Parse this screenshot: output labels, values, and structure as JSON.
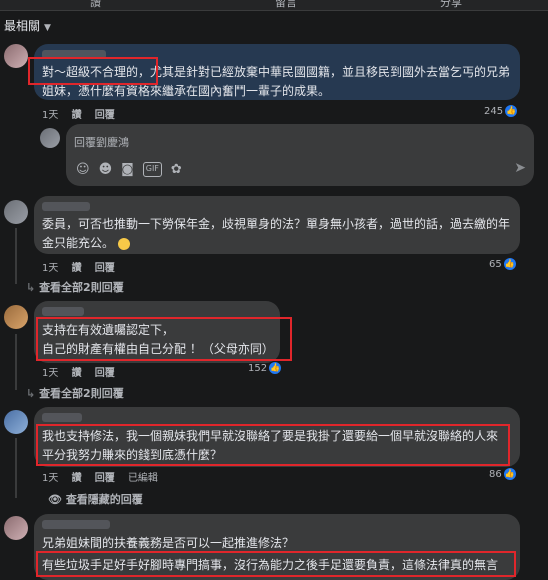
{
  "action_bar": {
    "like": "讚",
    "comment": "留言",
    "share": "分享"
  },
  "sort_label": "最相關",
  "comments": [
    {
      "text": "對～超級不合理的，尤其是針對已經放棄中華民國國籍，並且移民到國外去當乞丐的兄弟姐妹，憑什麼有資格來繼承在國內奮鬥一輩子的成果。",
      "time": "1天",
      "like": "讚",
      "reply": "回覆",
      "count": "245"
    },
    {
      "text": "委員，可否也推動一下勞保年金，歧視單身的法？單身無小孩者，過世的話，過去繳的年金只能充公。",
      "time": "1天",
      "like": "讚",
      "reply": "回覆",
      "count": "65",
      "more": "查看全部2則回覆"
    },
    {
      "text": "支持在有效遺囑認定下，\n自己的財產有權由自己分配 ！（父母亦同）",
      "time": "1天",
      "like": "讚",
      "reply": "回覆",
      "count": "152",
      "more": "查看全部2則回覆"
    },
    {
      "text": "我也支持修法，我一個親妹我們早就沒聯絡了要是我掛了還要給一個早就沒聯絡的人來平分我努力賺來的錢到底憑什麼？",
      "time": "1天",
      "like": "讚",
      "reply": "回覆",
      "edited": "已編輯",
      "count": "86",
      "more": "查看隱藏的回覆"
    },
    {
      "text": "兄弟姐妹間的扶養義務是否可以一起推進修法？",
      "text2": "有些垃圾手足好手好腳時專門搞事，沒行為能力之後手足還要負責，這條法律真的無言"
    }
  ],
  "reply_box": {
    "placeholder": "回覆劉慶鴻"
  },
  "icons": [
    "sticker-icon",
    "emoji-icon",
    "camera-icon",
    "gif-icon",
    "avatar-sticker-icon",
    "send-icon"
  ],
  "colors": {
    "like_blue": "#2078f4",
    "highlight_red": "#e0262b",
    "bubble": "#3a3b3c",
    "bubble_highlight": "#263951"
  }
}
